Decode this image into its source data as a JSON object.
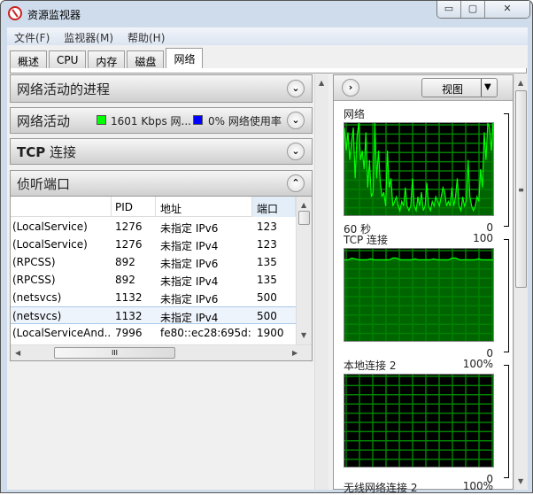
{
  "window": {
    "title": "资源监视器",
    "controls": [
      "minimize",
      "maximize",
      "close"
    ]
  },
  "menu": [
    "文件(F)",
    "监视器(M)",
    "帮助(H)"
  ],
  "tabs": [
    {
      "label": "概述"
    },
    {
      "label": "CPU"
    },
    {
      "label": "内存"
    },
    {
      "label": "磁盘"
    },
    {
      "label": "网络",
      "active": true
    }
  ],
  "sections": {
    "processes": {
      "title": "网络活动的进程",
      "expanded": false
    },
    "activity": {
      "title": "网络活动",
      "stat1": "1601 Kbps 网...",
      "stat1_color": "#00ff00",
      "stat2": "0% 网络使用率",
      "stat2_color": "#0000ff",
      "expanded": false
    },
    "tcp": {
      "title_bold": "TCP",
      "title": "连接",
      "expanded": false
    },
    "listening": {
      "title": "侦听端口",
      "expanded": true
    }
  },
  "table": {
    "columns": [
      "",
      "PID",
      "地址",
      "端口"
    ],
    "sorted_column": "端口",
    "rows": [
      [
        "(LocalService)",
        "1276",
        "未指定 IPv6",
        "123"
      ],
      [
        "(LocalService)",
        "1276",
        "未指定 IPv4",
        "123"
      ],
      [
        "(RPCSS)",
        "892",
        "未指定 IPv6",
        "135"
      ],
      [
        "(RPCSS)",
        "892",
        "未指定 IPv4",
        "135"
      ],
      [
        "(netsvcs)",
        "1132",
        "未指定 IPv6",
        "500"
      ],
      [
        "(netsvcs)",
        "1132",
        "未指定 IPv4",
        "500"
      ],
      [
        "(LocalServiceAnd...",
        "7996",
        "fe80::ec28:695d:...",
        "1900"
      ]
    ],
    "highlighted_row": 5
  },
  "right": {
    "view_button": "视图",
    "graphs": [
      {
        "label": "网络",
        "max": "",
        "time": "60 秒",
        "min": "0",
        "values": [
          95,
          70,
          90,
          60,
          80,
          95,
          40,
          85,
          100,
          60,
          70,
          50,
          90,
          30,
          60,
          20,
          25,
          100,
          40,
          70,
          35,
          20,
          25,
          10,
          70,
          30,
          40,
          10,
          15,
          20,
          10,
          5,
          15,
          10,
          30,
          10,
          5,
          10,
          40,
          10,
          5,
          20,
          10,
          25,
          5,
          10,
          35,
          10,
          5,
          15,
          10,
          20,
          15,
          10,
          20,
          30,
          25,
          10,
          15,
          10,
          30,
          10,
          20,
          40,
          10,
          5,
          20,
          10,
          15,
          60,
          20,
          10,
          5,
          10,
          20,
          15,
          50,
          30,
          90,
          60,
          100,
          95,
          70,
          100
        ]
      },
      {
        "label": "TCP 连接",
        "max": "100",
        "min": "0",
        "values": [
          88,
          88,
          90,
          89,
          88,
          88,
          88,
          89,
          88,
          88,
          88,
          88,
          88,
          90,
          90,
          88,
          88,
          88,
          88,
          89,
          88,
          88,
          88,
          88,
          89,
          88,
          88,
          88,
          88,
          90,
          90,
          88,
          88,
          88,
          88,
          88,
          89,
          88,
          88,
          88,
          88
        ]
      },
      {
        "label": "本地连接 2",
        "max": "100%",
        "min": "0",
        "values": []
      },
      {
        "label": "无线网络连接 2",
        "max": "100%"
      }
    ],
    "graph_colors": {
      "line": "#00ff00",
      "fill": "#006400",
      "grid": "#008000",
      "bg": "#000000"
    }
  }
}
